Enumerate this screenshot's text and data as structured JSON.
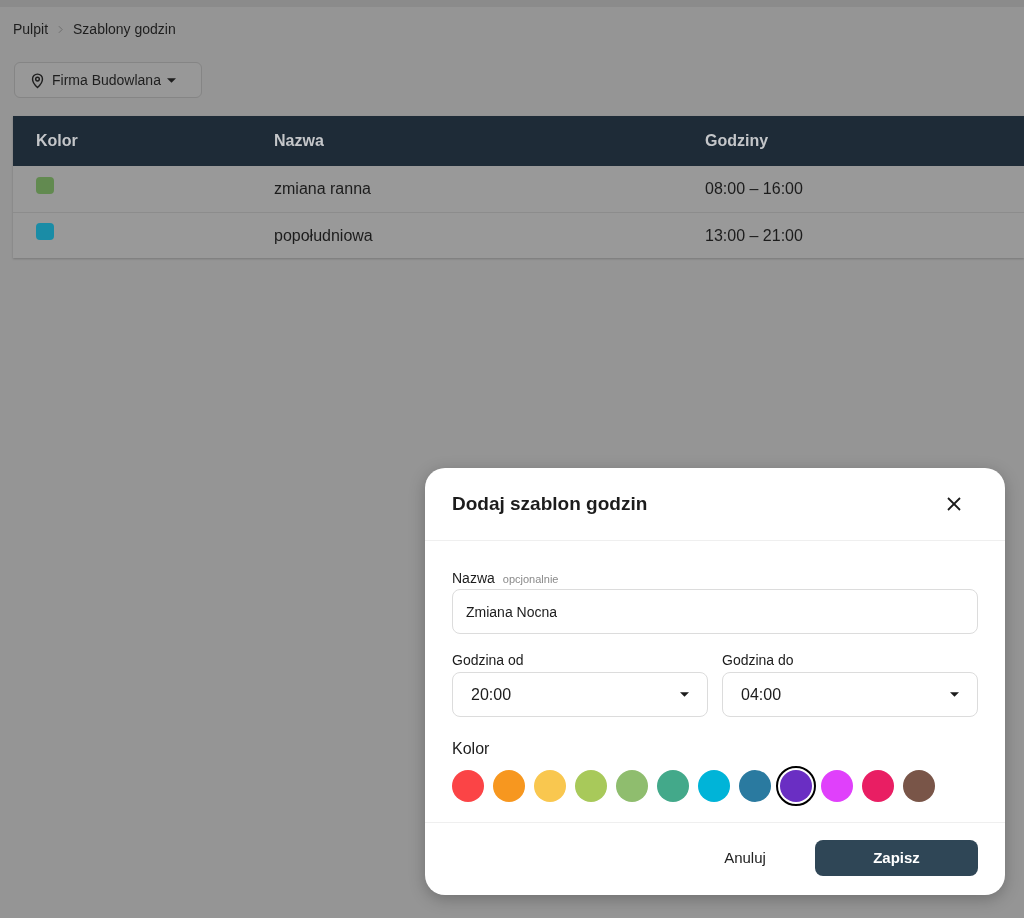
{
  "breadcrumb": [
    {
      "label": "Pulpit"
    },
    {
      "label": "Szablony godzin"
    }
  ],
  "location_picker": {
    "label": "Firma Budowlana"
  },
  "table": {
    "columns": [
      "Kolor",
      "Nazwa",
      "Godziny"
    ],
    "rows": [
      {
        "color": "#628a50",
        "name": "zmiana ranna",
        "hours": "08:00 – 16:00"
      },
      {
        "color": "#1a8ca6",
        "name": "popołudniowa",
        "hours": "13:00 – 21:00"
      }
    ]
  },
  "dialog": {
    "title": "Dodaj szablon godzin",
    "name_field": {
      "label": "Nazwa",
      "hint": "opcjonalnie",
      "value": "Zmiana Nocna"
    },
    "time_fields": [
      {
        "label": "Godzina od",
        "value": "20:00"
      },
      {
        "label": "Godzina do",
        "value": "04:00"
      }
    ],
    "color_label": "Kolor",
    "colors": [
      {
        "color": "#fb4446",
        "selected": false
      },
      {
        "color": "#f7971f",
        "selected": false
      },
      {
        "color": "#f9c74f",
        "selected": false
      },
      {
        "color": "#a8c95a",
        "selected": false
      },
      {
        "color": "#8fbd6e",
        "selected": false
      },
      {
        "color": "#43a98a",
        "selected": false
      },
      {
        "color": "#00b4d8",
        "selected": false
      },
      {
        "color": "#2a7aa0",
        "selected": false
      },
      {
        "color": "#6a2ec3",
        "selected": true
      },
      {
        "color": "#e040fb",
        "selected": false
      },
      {
        "color": "#e91e63",
        "selected": false
      },
      {
        "color": "#795548",
        "selected": false
      }
    ],
    "buttons": [
      {
        "label": "Anuluj",
        "kind": "secondary"
      },
      {
        "label": "Zapisz",
        "kind": "primary"
      }
    ]
  }
}
